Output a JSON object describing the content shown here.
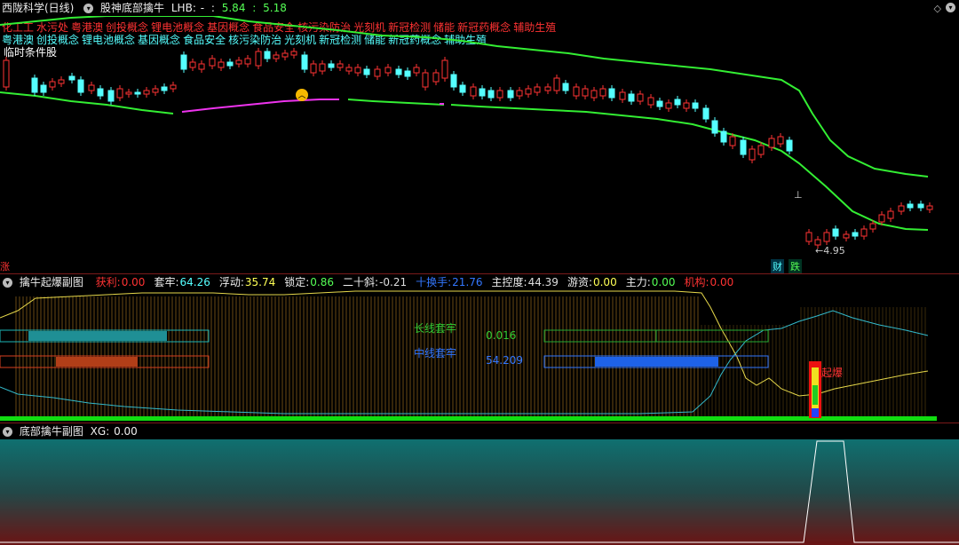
{
  "main": {
    "stock_name": "西陇科学(日线)",
    "indicator_name": "股神底部擒牛",
    "lhb_label": "LHB:",
    "lhb_value": "-",
    "price_a": "5.84",
    "price_b": "5.18",
    "concepts_line1": [
      "化工工",
      "水污处",
      "粤港澳",
      "创投概念",
      "锂电池概念",
      "基因概念",
      "食品安全",
      "核污染防治",
      "光刻机",
      "新冠检测",
      "储能",
      "新冠药概念",
      "辅助生殖"
    ],
    "concepts_line2": [
      "粤港澳",
      "创投概念",
      "锂电池概念",
      "基因概念",
      "食品安全",
      "核污染防治",
      "光刻机",
      "新冠检测",
      "储能",
      "新冠药概念",
      "辅助生殖"
    ],
    "temp_label": "临时条件股",
    "low_price_label": "←4.95",
    "rise_label": "涨",
    "finance_label": "财",
    "fall_label": "跌",
    "colors": {
      "up": "#ff3333",
      "down": "#55ffff",
      "band": "#33ee33",
      "magenta": "#ee33ee"
    }
  },
  "sub1": {
    "title": "擒牛起爆副图",
    "metrics": [
      {
        "label": "获利:",
        "value": "0.00",
        "color": "#ff3333"
      },
      {
        "label": "套牢:",
        "value": "64.26",
        "color": "#55ffff"
      },
      {
        "label": "浮动:",
        "value": "35.74",
        "color": "#ffff55"
      },
      {
        "label": "锁定:",
        "value": "0.86",
        "color": "#55ff55"
      },
      {
        "label": "二十斜:",
        "value": "-0.21",
        "color": "#dddddd"
      },
      {
        "label": "十换手:",
        "value": "21.76",
        "color": "#3377ff"
      },
      {
        "label": "主控度:",
        "value": "44.39",
        "color": "#dddddd"
      },
      {
        "label": "游资:",
        "value": "0.00",
        "color": "#ffff55"
      },
      {
        "label": "主力:",
        "value": "0.00",
        "color": "#55ff55"
      },
      {
        "label": "机构:",
        "value": "0.00",
        "color": "#ff3333"
      }
    ],
    "long_label": "长线套牢",
    "long_value": "0.016",
    "mid_label": "中线套牢",
    "mid_value": "54.209",
    "burst_label": "起爆"
  },
  "sub2": {
    "title": "底部擒牛副图",
    "xg_label": "XG:",
    "xg_value": "0.00"
  }
}
